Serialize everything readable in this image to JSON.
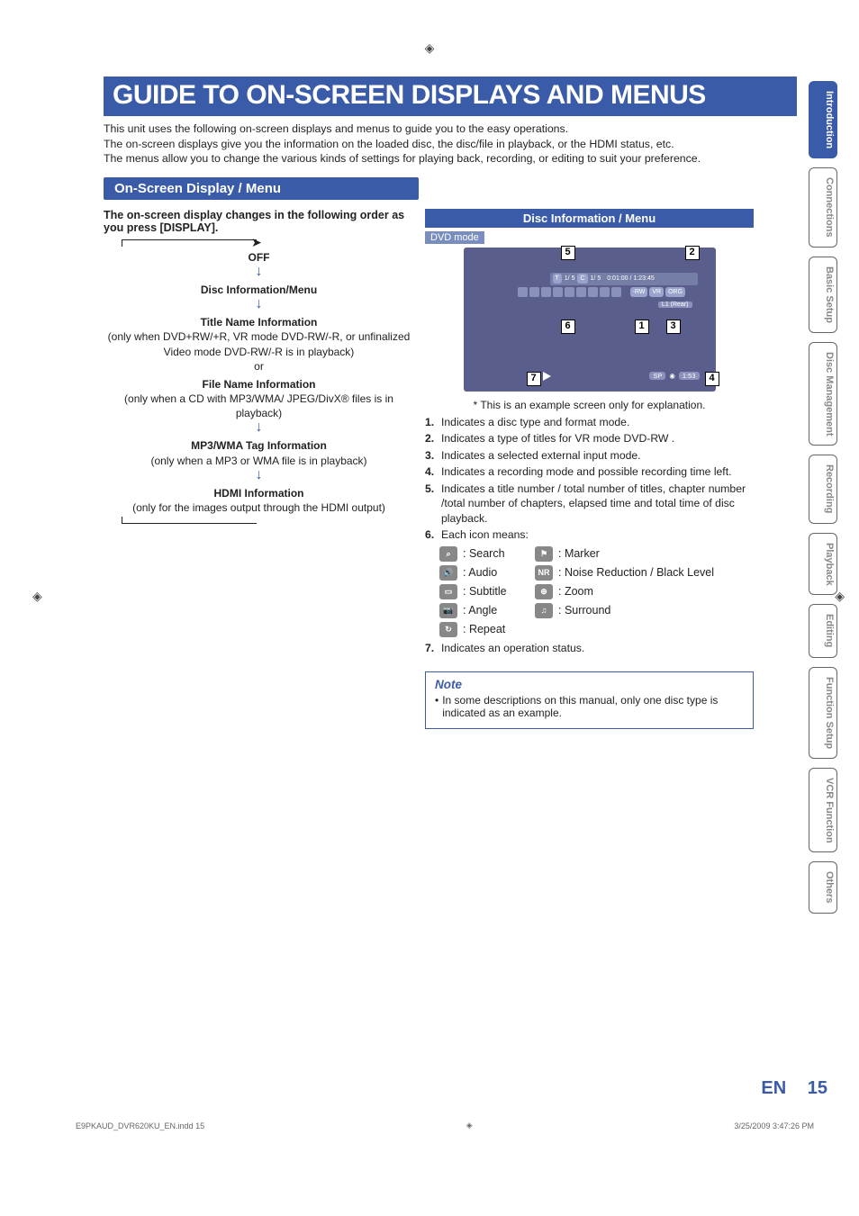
{
  "title": "GUIDE TO ON-SCREEN DISPLAYS AND MENUS",
  "intro": "This unit uses the following on-screen displays and menus to guide you to the easy operations.\nThe on-screen displays give you the information on the loaded disc, the disc/file in playback, or the HDMI status, etc.\nThe menus allow you to change the various kinds of settings for playing back, recording, or editing to suit your preference.",
  "section_heading": "On-Screen Display / Menu",
  "left": {
    "lead": "The on-screen display changes in the following order as you press [DISPLAY].",
    "off": "OFF",
    "disc_info": "Disc Information/Menu",
    "title_name": "Title Name Information",
    "title_name_sub": "(only when DVD+RW/+R, VR mode DVD-RW/-R, or unfinalized Video mode DVD-RW/-R is in playback)",
    "or": "or",
    "file_name": "File Name Information",
    "file_name_sub": "(only when a CD with MP3/WMA/ JPEG/DivX® files is in playback)",
    "mp3_tag": "MP3/WMA Tag Information",
    "mp3_tag_sub": "(only when a MP3 or WMA file is in playback)",
    "hdmi": "HDMI Information",
    "hdmi_sub": "(only for the images output through the HDMI output)"
  },
  "right": {
    "header": "Disc Information / Menu",
    "dvd_mode": "DVD mode",
    "callouts": {
      "c1": "1",
      "c2": "2",
      "c3": "3",
      "c4": "4",
      "c5": "5",
      "c6": "6",
      "c7": "7"
    },
    "strip": {
      "t": "T",
      "tval": "1/  5",
      "c": "C",
      "cval": "1/  5",
      "time": "0:01:00 / 1:23:45"
    },
    "pills": {
      "rw": "-RW",
      "vr": "VR",
      "org": "ORG"
    },
    "l1": "L1 (Rear)",
    "bottom": {
      "sp": "SP",
      "rec_time": "1:53"
    },
    "star_note": "* This is an example screen only for explanation.",
    "items": [
      "Indicates a disc type and format mode.",
      "Indicates a type of titles for VR mode DVD-RW .",
      "Indicates a selected external input mode.",
      "Indicates a recording mode and possible recording time left.",
      "Indicates a title number / total number of titles, chapter number /total number of chapters, elapsed time and total time of disc playback.",
      "Each icon means:"
    ],
    "icons": {
      "search": ": Search",
      "audio": ": Audio",
      "subtitle": ": Subtitle",
      "angle": ": Angle",
      "repeat": ": Repeat",
      "marker": ": Marker",
      "nr": ": Noise Reduction / Black Level",
      "zoom": ": Zoom",
      "surround": ": Surround"
    },
    "item7": "Indicates an operation status."
  },
  "note": {
    "title": "Note",
    "body": "In some descriptions on this manual, only one disc type is indicated as an example."
  },
  "side_tabs": [
    "Introduction",
    "Connections",
    "Basic Setup",
    "Disc Management",
    "Recording",
    "Playback",
    "Editing",
    "Function Setup",
    "VCR Function",
    "Others"
  ],
  "footer": {
    "en": "EN",
    "page": "15"
  },
  "file_footer": {
    "left": "E9PKAUD_DVR620KU_EN.indd   15",
    "right": "3/25/2009   3:47:26 PM"
  }
}
